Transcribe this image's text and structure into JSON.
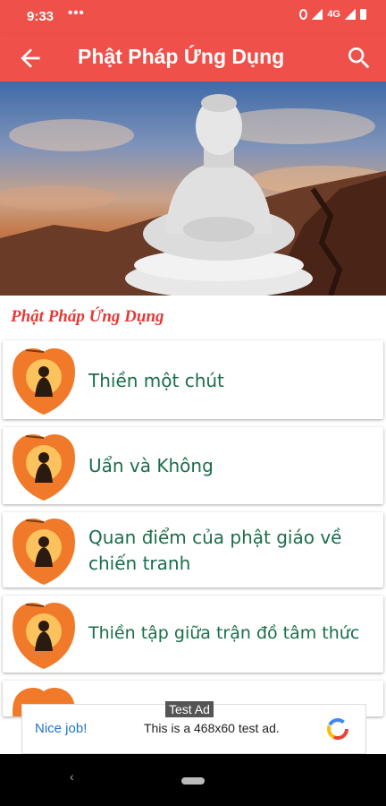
{
  "status_bar": {
    "time": "9:33",
    "dots": "•••",
    "network": "4G"
  },
  "app_bar": {
    "title": "Phật Pháp Ứng Dụng",
    "back_icon": "arrow-back-icon",
    "search_icon": "search-icon"
  },
  "hero": {
    "image": "buddha-statue-sunset-image"
  },
  "section": {
    "title": "Phật Pháp Ứng Dụng"
  },
  "items": [
    {
      "label": "Thiền một chút"
    },
    {
      "label": "Uẩn và Không"
    },
    {
      "label": "Quan điểm của phật giáo về chiến tranh"
    },
    {
      "label": "Thiền tập giữa trận đồ tâm thức"
    }
  ],
  "ad": {
    "tag": "Test Ad",
    "headline": "Nice job!",
    "body": "This is a 468x60 test ad."
  },
  "colors": {
    "primary": "#f0504a",
    "section_title": "#e53935",
    "item_text": "#1a6e4a"
  }
}
